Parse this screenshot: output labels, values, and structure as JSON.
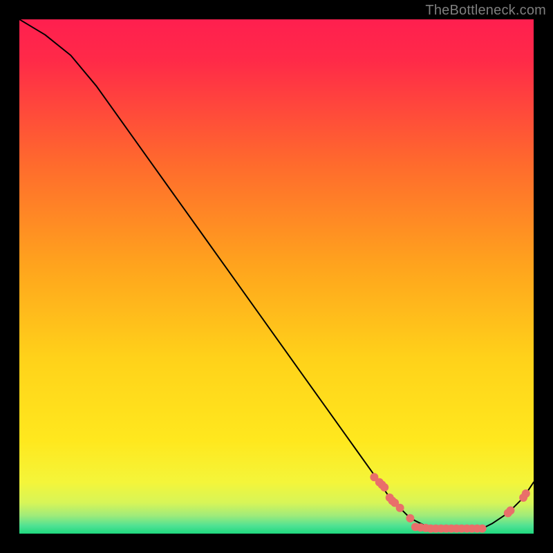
{
  "watermark": "TheBottleneck.com",
  "chart_data": {
    "type": "line",
    "title": "",
    "xlabel": "",
    "ylabel": "",
    "xlim": [
      0,
      100
    ],
    "ylim": [
      0,
      100
    ],
    "grid": false,
    "legend": false,
    "series": [
      {
        "name": "curve",
        "x": [
          0,
          5,
          10,
          15,
          20,
          25,
          30,
          35,
          40,
          45,
          50,
          55,
          60,
          65,
          70,
          72,
          76,
          80,
          84,
          88,
          90,
          92,
          95,
          98,
          100
        ],
        "values": [
          100,
          97,
          93,
          87,
          80,
          73,
          66,
          59,
          52,
          45,
          38,
          31,
          24,
          17,
          10,
          7,
          3,
          1,
          1,
          1,
          1,
          2,
          4,
          7,
          10
        ]
      }
    ],
    "markers": {
      "name": "dots",
      "color": "#e96f6a",
      "points": [
        {
          "x": 69,
          "y": 11
        },
        {
          "x": 70,
          "y": 10
        },
        {
          "x": 70.5,
          "y": 9.5
        },
        {
          "x": 71,
          "y": 9
        },
        {
          "x": 72,
          "y": 7
        },
        {
          "x": 72.5,
          "y": 6.4
        },
        {
          "x": 73,
          "y": 6
        },
        {
          "x": 74,
          "y": 5
        },
        {
          "x": 76,
          "y": 3
        },
        {
          "x": 77,
          "y": 1.3
        },
        {
          "x": 78,
          "y": 1.2
        },
        {
          "x": 79,
          "y": 1.1
        },
        {
          "x": 80,
          "y": 1
        },
        {
          "x": 81,
          "y": 1
        },
        {
          "x": 82,
          "y": 1
        },
        {
          "x": 83,
          "y": 1
        },
        {
          "x": 84,
          "y": 1
        },
        {
          "x": 85,
          "y": 1
        },
        {
          "x": 86,
          "y": 1
        },
        {
          "x": 87,
          "y": 1
        },
        {
          "x": 88,
          "y": 1
        },
        {
          "x": 89,
          "y": 1
        },
        {
          "x": 90,
          "y": 1
        },
        {
          "x": 95,
          "y": 4
        },
        {
          "x": 95.5,
          "y": 4.5
        },
        {
          "x": 98,
          "y": 7
        },
        {
          "x": 98.5,
          "y": 7.8
        }
      ]
    },
    "background_gradient": {
      "top_color": "#ff1f4f",
      "mid_color": "#ffde23",
      "bottom_band_color": "#1fe07e"
    }
  }
}
